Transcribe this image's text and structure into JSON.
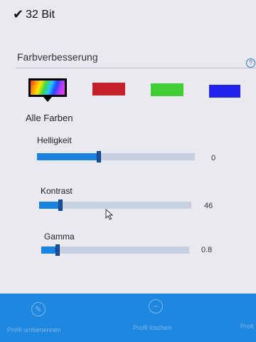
{
  "top": {
    "check_mark": "✔",
    "label": "32 Bit"
  },
  "section": {
    "title": "Farbverbesserung",
    "help_symbol": "?"
  },
  "colors": {
    "selected": "Alle Farben",
    "swatches": [
      {
        "name": "all",
        "color": "rainbow"
      },
      {
        "name": "red",
        "color": "#c4202a"
      },
      {
        "name": "green",
        "color": "#3fcf33"
      },
      {
        "name": "blue",
        "color": "#2222ee"
      }
    ]
  },
  "sliders": {
    "brightness": {
      "label": "Helligkeit",
      "value": "0",
      "level": 0.39
    },
    "contrast": {
      "label": "Kontrast",
      "value": "46",
      "level": 0.14
    },
    "gamma": {
      "label": "Gamma",
      "value": "0.8",
      "level": 0.11
    }
  },
  "bottom_bar": {
    "rename_label": "Profil umbenennen",
    "delete_label": "Profil löschen",
    "third_label": "Profi"
  },
  "theme": {
    "accent": "#1a83e0",
    "bar": "#1e88e0"
  }
}
